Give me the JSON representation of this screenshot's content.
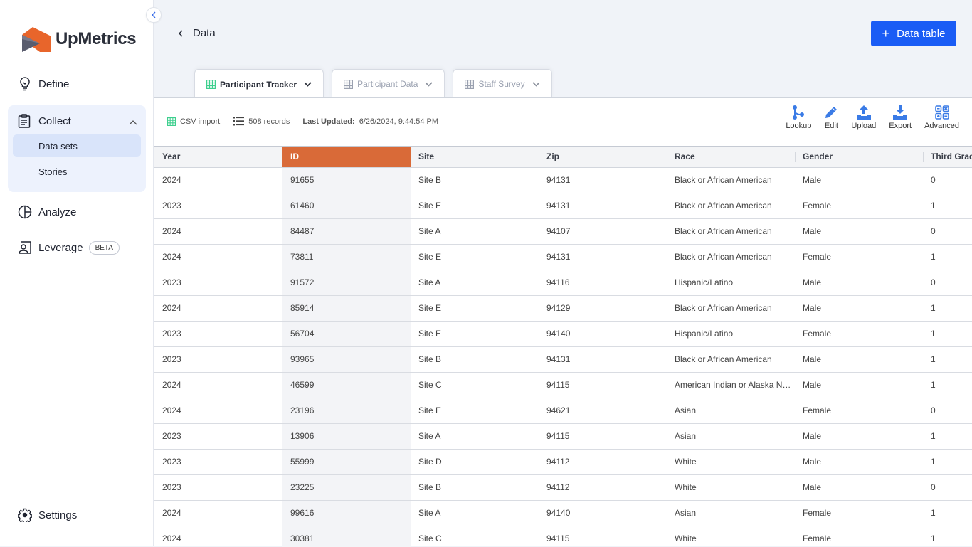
{
  "brand": {
    "name": "UpMetrics",
    "accent": "#1a5cf5",
    "logo_orange": "#e8652b",
    "logo_gray": "#5a5d6e"
  },
  "sidebar": {
    "collapse_icon": "chevron-left-icon",
    "items": [
      {
        "label": "Define",
        "icon": "lightbulb-icon"
      },
      {
        "label": "Collect",
        "icon": "clipboard-icon",
        "expanded": true,
        "children": [
          {
            "label": "Data sets",
            "active": true
          },
          {
            "label": "Stories"
          }
        ]
      },
      {
        "label": "Analyze",
        "icon": "pie-chart-icon"
      },
      {
        "label": "Leverage",
        "icon": "presenter-icon",
        "badge": "BETA"
      }
    ],
    "settings": {
      "label": "Settings",
      "icon": "gear-icon"
    }
  },
  "header": {
    "back_label": "Data",
    "add_button": "Data table"
  },
  "tabs": [
    {
      "label": "Participant Tracker",
      "active": true
    },
    {
      "label": "Participant Data"
    },
    {
      "label": "Staff Survey"
    }
  ],
  "meta": {
    "source": "CSV import",
    "records": "508 records",
    "last_updated_label": "Last Updated:",
    "last_updated_value": "6/26/2024, 9:44:54 PM"
  },
  "actions": [
    {
      "label": "Lookup",
      "icon": "branch-icon"
    },
    {
      "label": "Edit",
      "icon": "pencil-icon"
    },
    {
      "label": "Upload",
      "icon": "upload-icon"
    },
    {
      "label": "Export",
      "icon": "download-icon"
    },
    {
      "label": "Advanced",
      "icon": "grid-options-icon"
    }
  ],
  "table": {
    "selected_column": "ID",
    "selected_color": "#d96a38",
    "columns": [
      "Year",
      "ID",
      "Site",
      "Zip",
      "Race",
      "Gender",
      "Third Grade"
    ],
    "rows": [
      [
        "2024",
        "91655",
        "Site B",
        "94131",
        "Black or African American",
        "Male",
        "0"
      ],
      [
        "2023",
        "61460",
        "Site E",
        "94131",
        "Black or African American",
        "Female",
        "1"
      ],
      [
        "2024",
        "84487",
        "Site A",
        "94107",
        "Black or African American",
        "Male",
        "0"
      ],
      [
        "2024",
        "73811",
        "Site E",
        "94131",
        "Black or African American",
        "Female",
        "1"
      ],
      [
        "2023",
        "91572",
        "Site A",
        "94116",
        "Hispanic/Latino",
        "Male",
        "0"
      ],
      [
        "2024",
        "85914",
        "Site E",
        "94129",
        "Black or African American",
        "Male",
        "1"
      ],
      [
        "2023",
        "56704",
        "Site E",
        "94140",
        "Hispanic/Latino",
        "Female",
        "1"
      ],
      [
        "2023",
        "93965",
        "Site B",
        "94131",
        "Black or African American",
        "Male",
        "1"
      ],
      [
        "2024",
        "46599",
        "Site C",
        "94115",
        "American Indian or Alaska Native",
        "Male",
        "1"
      ],
      [
        "2024",
        "23196",
        "Site E",
        "94621",
        "Asian",
        "Female",
        "0"
      ],
      [
        "2023",
        "13906",
        "Site A",
        "94115",
        "Asian",
        "Male",
        "1"
      ],
      [
        "2023",
        "55999",
        "Site D",
        "94112",
        "White",
        "Male",
        "1"
      ],
      [
        "2023",
        "23225",
        "Site B",
        "94112",
        "White",
        "Male",
        "0"
      ],
      [
        "2024",
        "99616",
        "Site A",
        "94140",
        "Asian",
        "Female",
        "1"
      ],
      [
        "2024",
        "30381",
        "Site C",
        "94115",
        "White",
        "Female",
        "1"
      ]
    ]
  }
}
